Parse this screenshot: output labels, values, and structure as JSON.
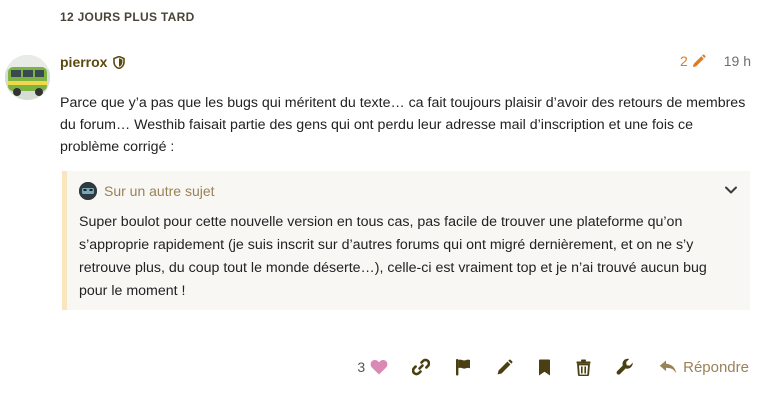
{
  "small_action": {
    "label": "12 JOURS PLUS TARD"
  },
  "post": {
    "username": "pierrox",
    "edit_count": "2",
    "age": "19 h",
    "body": "Parce que y’a pas que les bugs qui méritent du texte… ca fait toujours plaisir d’avoir des retours de membres du forum… Westhib faisait partie des gens qui ont perdu leur adresse mail d’inscription et une fois ce problème corrigé :",
    "icons": {
      "moderator": "shield-icon",
      "edit": "pencil-icon"
    }
  },
  "quote": {
    "title": "Sur un autre sujet",
    "text": "Super boulot pour cette nouvelle version en tous cas, pas facile de trouver une plateforme qu’on s’approprie rapidement (je suis inscrit sur d’autres forums qui ont migré dernièrement, et on ne s’y retrouve plus, du coup tout le monde déserte…), celle-ci est vraiment top et je n’ai trouvé aucun bug pour le moment !"
  },
  "actions": {
    "like_count": "3",
    "reply_label": "Répondre"
  },
  "colors": {
    "brand_gold": "#9a8257",
    "username": "#5b4a10",
    "edit_orange": "#e47a1f",
    "like_pink": "#d989b4",
    "quote_bg": "#f8f7f4",
    "quote_border": "#f8e6bf",
    "action_icon": "#4a3f12"
  }
}
